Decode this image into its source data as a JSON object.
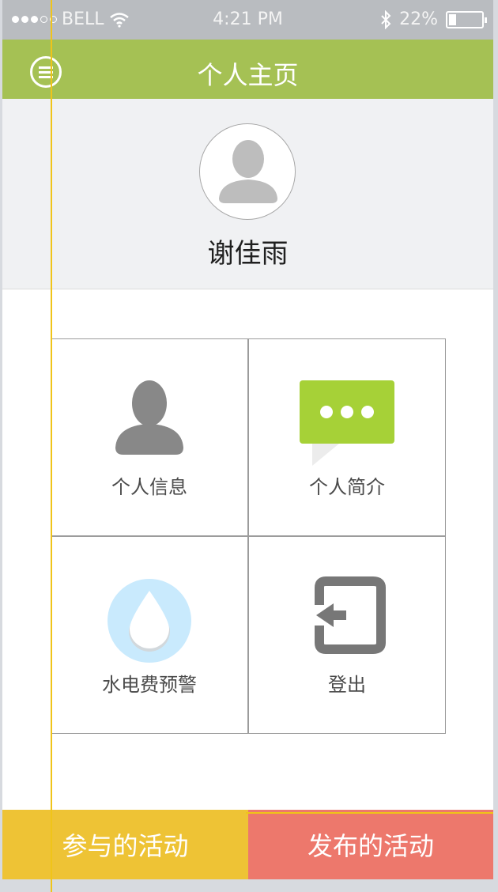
{
  "statusbar": {
    "carrier": "BELL",
    "time": "4:21 PM",
    "battery": "22%",
    "battery_level": 0.22
  },
  "navbar": {
    "title": "个人主页",
    "menu_icon": "menu-icon"
  },
  "profile": {
    "name": "谢佳雨",
    "avatar_icon": "user-avatar-icon"
  },
  "grid": {
    "items": [
      {
        "label": "个人信息",
        "icon": "person-icon"
      },
      {
        "label": "个人简介",
        "icon": "chat-bubble-icon"
      },
      {
        "label": "水电费预警",
        "icon": "water-drop-icon"
      },
      {
        "label": "登出",
        "icon": "logout-icon"
      }
    ]
  },
  "bottom_bar": {
    "left_label": "参与的活动",
    "right_label": "发布的活动"
  },
  "colors": {
    "nav_green": "#a5c154",
    "chat_green": "#a6d137",
    "drop_blue": "#c9eafd",
    "yellow": "#eec335",
    "coral": "#ed786c",
    "icon_gray": "#888888"
  }
}
